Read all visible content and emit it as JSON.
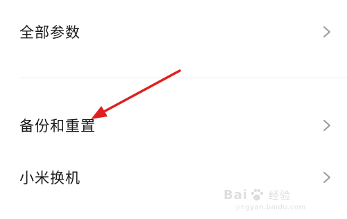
{
  "settings": {
    "items": [
      {
        "label": "全部参数",
        "icon": "chevron-right-icon"
      },
      {
        "label": "备份和重置",
        "icon": "chevron-right-icon"
      },
      {
        "label": "小米换机",
        "icon": "chevron-right-icon"
      }
    ]
  },
  "annotation": {
    "arrow_color": "#e0201f",
    "points_to": "备份和重置"
  },
  "watermark": {
    "brand": "Bai",
    "brand_suffix": "经验",
    "url": "jingyan.baidu.com"
  },
  "colors": {
    "background": "#ffffff",
    "text": "#1a1a1a",
    "chevron": "#9a9a9a",
    "divider": "#ededed"
  }
}
